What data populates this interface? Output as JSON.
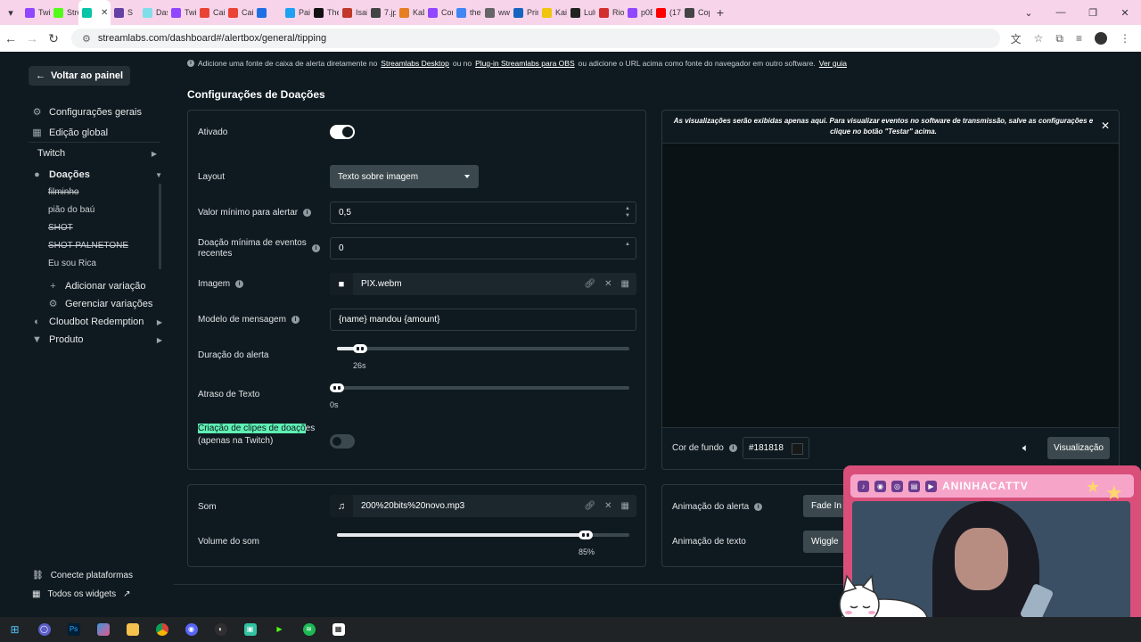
{
  "browser": {
    "tabs": [
      {
        "label": "Twit",
        "color": "#9146ff"
      },
      {
        "label": "Stre",
        "color": "#53fc18"
      },
      {
        "label": "",
        "color": "#09c5a7",
        "active": true
      },
      {
        "label": "S",
        "color": "#6441a5"
      },
      {
        "label": "Das",
        "color": "#80deea"
      },
      {
        "label": "Twit",
        "color": "#9146ff"
      },
      {
        "label": "Caix",
        "color": "#ea4335"
      },
      {
        "label": "Caix",
        "color": "#ea4335"
      },
      {
        "label": "",
        "color": "#1f6fe5"
      },
      {
        "label": "Pain",
        "color": "#1da1f2"
      },
      {
        "label": "The",
        "color": "#111111"
      },
      {
        "label": "Isai",
        "color": "#c0392b"
      },
      {
        "label": "7.jp",
        "color": "#444444"
      },
      {
        "label": "KaB",
        "color": "#e67e22"
      },
      {
        "label": "Cor",
        "color": "#9146ff"
      },
      {
        "label": "the",
        "color": "#4285f4"
      },
      {
        "label": "ww",
        "color": "#666666"
      },
      {
        "label": "Prin",
        "color": "#1565c0"
      },
      {
        "label": "Kaij",
        "color": "#f1c40f"
      },
      {
        "label": "Lulu",
        "color": "#222222"
      },
      {
        "label": "Riot",
        "color": "#d32f2f"
      },
      {
        "label": "p0B",
        "color": "#9146ff"
      },
      {
        "label": "(173",
        "color": "#ff0000"
      },
      {
        "label": "Cop",
        "color": "#444444"
      }
    ],
    "url": "streamlabs.com/dashboard#/alertbox/general/tipping"
  },
  "sidebar": {
    "back": "Voltar ao painel",
    "general_settings": "Configurações gerais",
    "global_edit": "Edição global",
    "twitch": "Twitch",
    "donations": "Doações",
    "variations": [
      "filminho",
      "pião do baú",
      "SHOT",
      "SHOT PALNETONE",
      "Eu sou Rica"
    ],
    "add_variation": "Adicionar variação",
    "manage_variations": "Gerenciar variações",
    "cloudbot": "Cloudbot Redemption",
    "product": "Produto",
    "connect": "Conecte plataformas",
    "all_widgets": "Todos os widgets"
  },
  "info": {
    "pre": "Adicione uma fonte de caixa de alerta diretamente no",
    "link1": "Streamlabs Desktop",
    "mid1": "ou no",
    "link2": "Plug-in Streamlabs para OBS",
    "mid2": "ou adicione o URL acima como fonte do navegador em outro software.",
    "link3": "Ver guia"
  },
  "main": {
    "title": "Configurações de Doações",
    "enabled_label": "Ativado",
    "enabled": true,
    "layout_label": "Layout",
    "layout_value": "Texto sobre imagem",
    "min_value_label": "Valor mínimo para alertar",
    "min_value": "0,5",
    "min_recent_label": "Doação mínima de eventos recentes",
    "min_recent": "0",
    "image_label": "Imagem",
    "image_file": "PIX.webm",
    "message_label": "Modelo de mensagem",
    "message_template": "{name} mandou {amount}",
    "duration_label": "Duração do alerta",
    "duration_value": "26s",
    "duration_fraction": 0.08,
    "text_delay_label": "Atraso de Texto",
    "text_delay_value": "0s",
    "text_delay_fraction": 0.0,
    "clips_label_highlight": "Criação de clipes de doaçõ",
    "clips_label_rest": "es",
    "clips_label_line2": "(apenas na Twitch)",
    "clips_enabled": false
  },
  "sound": {
    "label": "Som",
    "file": "200%20bits%20novo.mp3",
    "volume_label": "Volume do som",
    "volume_value": "85%",
    "volume_fraction": 0.85
  },
  "preview": {
    "note": "As visualizações serão exibidas apenas aqui. Para visualizar eventos no software de transmissão, salve as configurações e clique no botão \"Testar\" acima.",
    "bg_label": "Cor de fundo",
    "bg_color": "#181818",
    "preview_button": "Visualização"
  },
  "animation": {
    "alert_label": "Animação do alerta",
    "alert_value": "Fade In",
    "text_label": "Animação de texto",
    "text_value": "Wiggle"
  },
  "stream_overlay": {
    "name": "ANINHACATTV"
  }
}
